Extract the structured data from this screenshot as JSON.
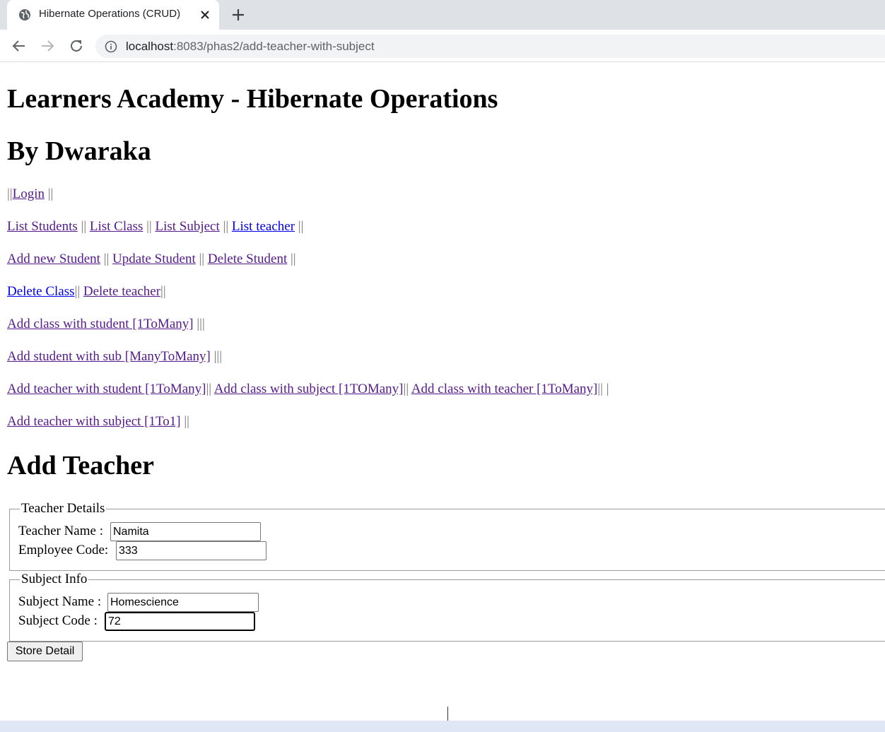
{
  "browser": {
    "tab_title": "Hibernate Operations (CRUD)",
    "url_host": "localhost",
    "url_path": ":8083/phas2/add-teacher-with-subject"
  },
  "page": {
    "title": "Learners Academy - Hibernate Operations",
    "byline": "By Dwaraka",
    "nav": {
      "line1": {
        "prefix": "||",
        "login": "Login",
        "suffix": " ||"
      },
      "line2": {
        "list_students": "List Students",
        "sep1": " || ",
        "list_class": "List Class",
        "sep2": " || ",
        "list_subject": "List Subject",
        "sep3": " || ",
        "list_teacher": "List teacher",
        "sep4": " ||"
      },
      "line3": {
        "add_student": "Add new Student",
        "sep1": " || ",
        "update_student": "Update Student",
        "sep2": " || ",
        "delete_student": "Delete Student",
        "sep3": " ||"
      },
      "line4": {
        "delete_class": "Delete Class",
        "sep1": "|| ",
        "delete_teacher": "Delete teacher",
        "sep2": "||"
      },
      "line5": {
        "add_class_student": "Add class with student [1ToMany]",
        "sep": " |||"
      },
      "line6": {
        "add_student_sub": "Add student with sub [ManyToMany]",
        "sep": " |||"
      },
      "line7": {
        "add_teacher_student": "Add teacher with student [1ToMany]",
        "sep1": "|| ",
        "add_class_subject": "Add class with subject [1TOMany]",
        "sep2": "|| ",
        "add_class_teacher": "Add class with teacher [1ToMany]",
        "sep3": "|| |"
      },
      "line8": {
        "add_teacher_subject": "Add teacher with subject [1To1]",
        "sep": " ||"
      }
    },
    "section_title": "Add Teacher",
    "teacher": {
      "legend": "Teacher Details",
      "name_label": "Teacher Name :",
      "name_value": "Namita",
      "code_label": "Employee Code:",
      "code_value": "333"
    },
    "subject": {
      "legend": "Subject Info",
      "name_label": "Subject Name :",
      "name_value": "Homescience",
      "code_label": "Subject Code :",
      "code_value": "72"
    },
    "submit_label": "Store Detail"
  }
}
